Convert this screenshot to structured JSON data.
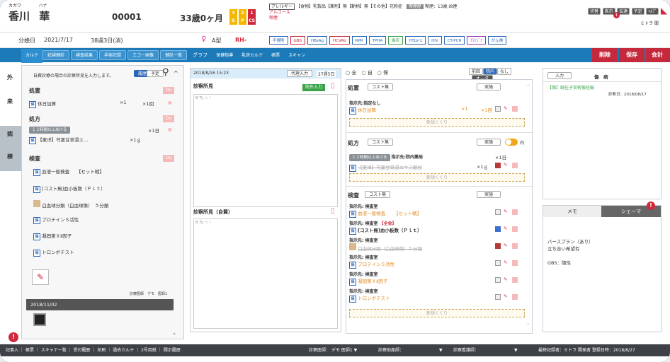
{
  "patient": {
    "kana_family": "カガワ",
    "kana_given": "ハナ",
    "family": "香川",
    "given": "華",
    "id": "00001",
    "age": "33歳0ヶ月",
    "badges": [
      "3",
      "2",
      "1"
    ],
    "badge_subs": [
      "G",
      "P",
      "CS"
    ],
    "due_label": "分娩日",
    "due_date": "2021/7/17",
    "gest": "38週3日(消)",
    "blood": "A型",
    "rh": "RH-"
  },
  "allergy": {
    "label": "アレルギー",
    "text1": "【食物】乳製品【薬剤】無【動物】無【その他】花粉症",
    "alcohol": "アルコール",
    "smoke_label": "喫煙",
    "smoke": "喫煙歴",
    "smoke_val": "喫煙：13歳 凶煙"
  },
  "labs": [
    "不規則",
    "GBS",
    "HBsAg",
    "HCVAb",
    "RPR",
    "TPHA",
    "風疹",
    "HTLV-1",
    "HIV",
    "CT-PCR",
    "ｸﾗﾐｼﾞｱ",
    "がん検"
  ],
  "topicons": [
    "切替",
    "表示",
    "伝達",
    "予定",
    "ﾍﾙﾌﾟ"
  ],
  "hospital": "ミトラ 聞",
  "tabs": [
    "カルテ",
    "妊婦健診",
    "検査結果",
    "手術記録",
    "エコー画像",
    "健診一覧",
    "グラフ",
    "保健指導",
    "乳房カルテ",
    "帳票",
    "スキャン"
  ],
  "actions": {
    "delete": "削除",
    "save": "保存",
    "accounting": "会計"
  },
  "sidetabs": [
    "外",
    "来",
    "病",
    "棟"
  ],
  "left": {
    "notice": "自費診療の場合の診察所見を入力します。",
    "btn1": "履歴",
    "btn2": "予定",
    "sec1": "処置",
    "do": "Do",
    "item1": "休日加算",
    "qty1": "×1",
    "qty1b": "×1回",
    "sec2": "処方",
    "rx_tag": "１２時間以上あける",
    "rx_qty": "×1日",
    "rx_item": "【東洋】芍薬甘草湯エ…",
    "rx_dose": "×1ｇ",
    "sec3": "検査",
    "tests": [
      "血液一般検査　　【セット戦】",
      "[コスト無]血小板数（Ｐｌｔ）",
      "白血球分類（白血球像）　５分類",
      "プロテインＳ活性",
      "凝固第ＸⅡ因子",
      "トロンボテスト"
    ],
    "doc": "診療医師　デモ　医師1",
    "date": "2018/11/02"
  },
  "center": {
    "datetime": "2018/8/16 15:23",
    "proxy": "代理入力",
    "week": "27週5日",
    "finding": "診察所見",
    "hospital_btn": "院外入力",
    "finding2": "診察所見（自費）",
    "toolbar": "B Ty ☆ ᶳ"
  },
  "right": {
    "radio": [
      "全",
      "自",
      "保"
    ],
    "btns": [
      "前回",
      "院内",
      "なし",
      "オーダ"
    ],
    "sec1": "処置",
    "cost": "コスト無",
    "exec": "実施",
    "dest1": "指示先:指定なし",
    "item1": "休日加算",
    "q1": "×1",
    "q1b": "×1回",
    "newbox": "新規くくり",
    "sec2": "処方",
    "rx_tag": "１２時間以上あける",
    "rx_dest": "指示先:院内薬局",
    "rx_qty": "×1日",
    "rx_item": "【東洋】芍薬甘草湯エキス顆粒",
    "rx_dose": "×1ｇ",
    "nai": "内",
    "sec3": "検査",
    "dest": "指示先: 検査室",
    "set": "【セット戦】",
    "all": "【全会】",
    "tests": [
      "血液一般検査",
      "[コスト無]血小板数（Ｐｌｔ）",
      "白血球分類（白血球像）５分類",
      "プロテインＳ活性",
      "凝固第ＸⅡ因子",
      "トロンボテスト"
    ]
  },
  "far": {
    "input": "入力",
    "disease": "傷　病",
    "item": "【保】既往子宮術後妊娠",
    "date": "診断日：2018/08/17",
    "memo": "メモ",
    "schema": "シェーマ",
    "lines": [
      "バースプラン（あり）",
      "立ち合い希望有",
      "",
      "GBS：陽性"
    ]
  },
  "footer": {
    "items": [
      "記事入",
      "帳票",
      "スキャナ一覧",
      "受付履歴",
      "印刷",
      "過去カルテ",
      "2号用紙",
      "開示履歴"
    ],
    "doctor": "診察医師：",
    "doctor_val": "デモ 医師1",
    "assist": "診察助産師：",
    "reg_by": "診察看護師：",
    "last": "最終記録者：ミトラ",
    "developer": "開発者",
    "reg_date": "登録日時：2018/8/27"
  }
}
